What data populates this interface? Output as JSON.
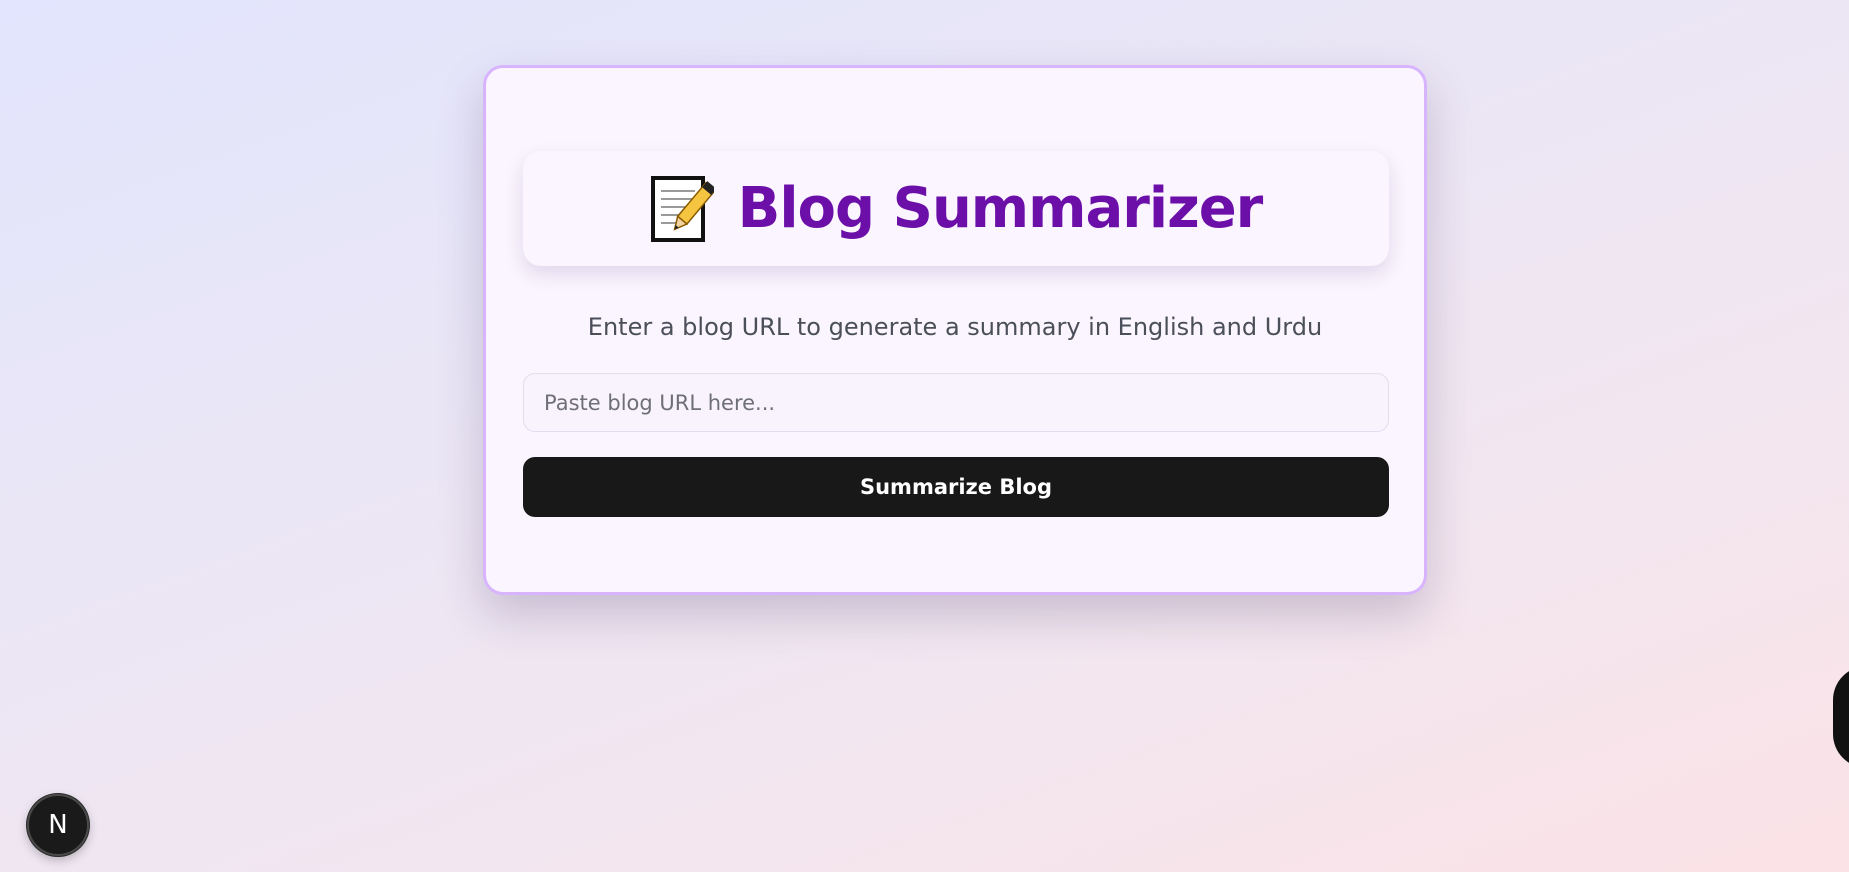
{
  "header": {
    "title": "Blog Summarizer",
    "icon": "memo-pencil-icon"
  },
  "form": {
    "subtitle": "Enter a blog URL to generate a summary in English and Urdu",
    "url_placeholder": "Paste blog URL here...",
    "url_value": "",
    "submit_label": "Summarize Blog"
  },
  "dev_badge": {
    "label": "N"
  },
  "colors": {
    "title": "#6b0fa8",
    "card_border": "#d8b4fe",
    "button_bg": "#181818",
    "button_text": "#ffffff"
  }
}
